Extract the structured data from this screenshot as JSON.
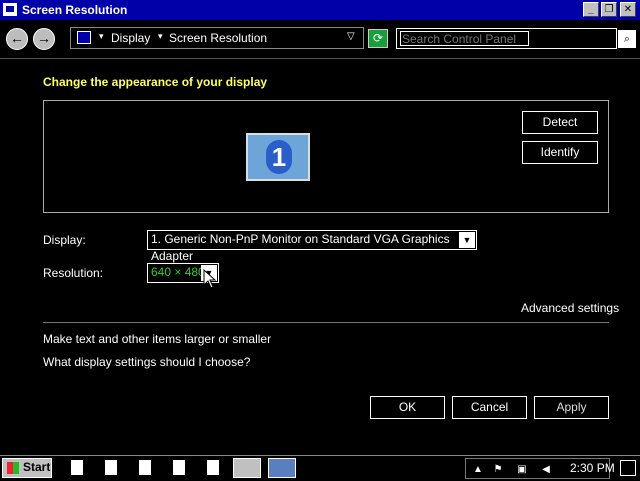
{
  "window": {
    "title": "Screen Resolution",
    "minimize_label": "_",
    "maximize_label": "❐",
    "close_label": "✕"
  },
  "address": {
    "back_label": "←",
    "forward_label": "→",
    "crumb_sep": "▾",
    "crumbs": [
      "Display",
      "Screen Resolution"
    ],
    "dropdown_label": "▽",
    "refresh_label": "⟳",
    "search_placeholder": "Search Control Panel",
    "search_icon": "⌕"
  },
  "main": {
    "heading": "Change the appearance of your display",
    "monitor_number": "1",
    "detect_label": "Detect",
    "identify_label": "Identify",
    "display_label": "Display:",
    "display_value": "1. Generic Non-PnP Monitor on Standard VGA Graphics Adapter",
    "resolution_label": "Resolution:",
    "resolution_value": "640 × 480",
    "dropdown_arrow": "▼",
    "advanced_link": "Advanced settings",
    "link_text_size": "Make text and other items larger or smaller",
    "link_which_settings": "What display settings should I choose?",
    "ok_label": "OK",
    "cancel_label": "Cancel",
    "apply_label": "Apply"
  },
  "taskbar": {
    "start_label": "Start",
    "clock": "2:30 PM",
    "tray_icons": [
      "flag-icon",
      "network-icon",
      "volume-mute-icon",
      "desktop-icon"
    ]
  },
  "colors": {
    "title_bar": "#0000a8",
    "heading": "#ffff66",
    "resolution_value": "#33cc33"
  }
}
